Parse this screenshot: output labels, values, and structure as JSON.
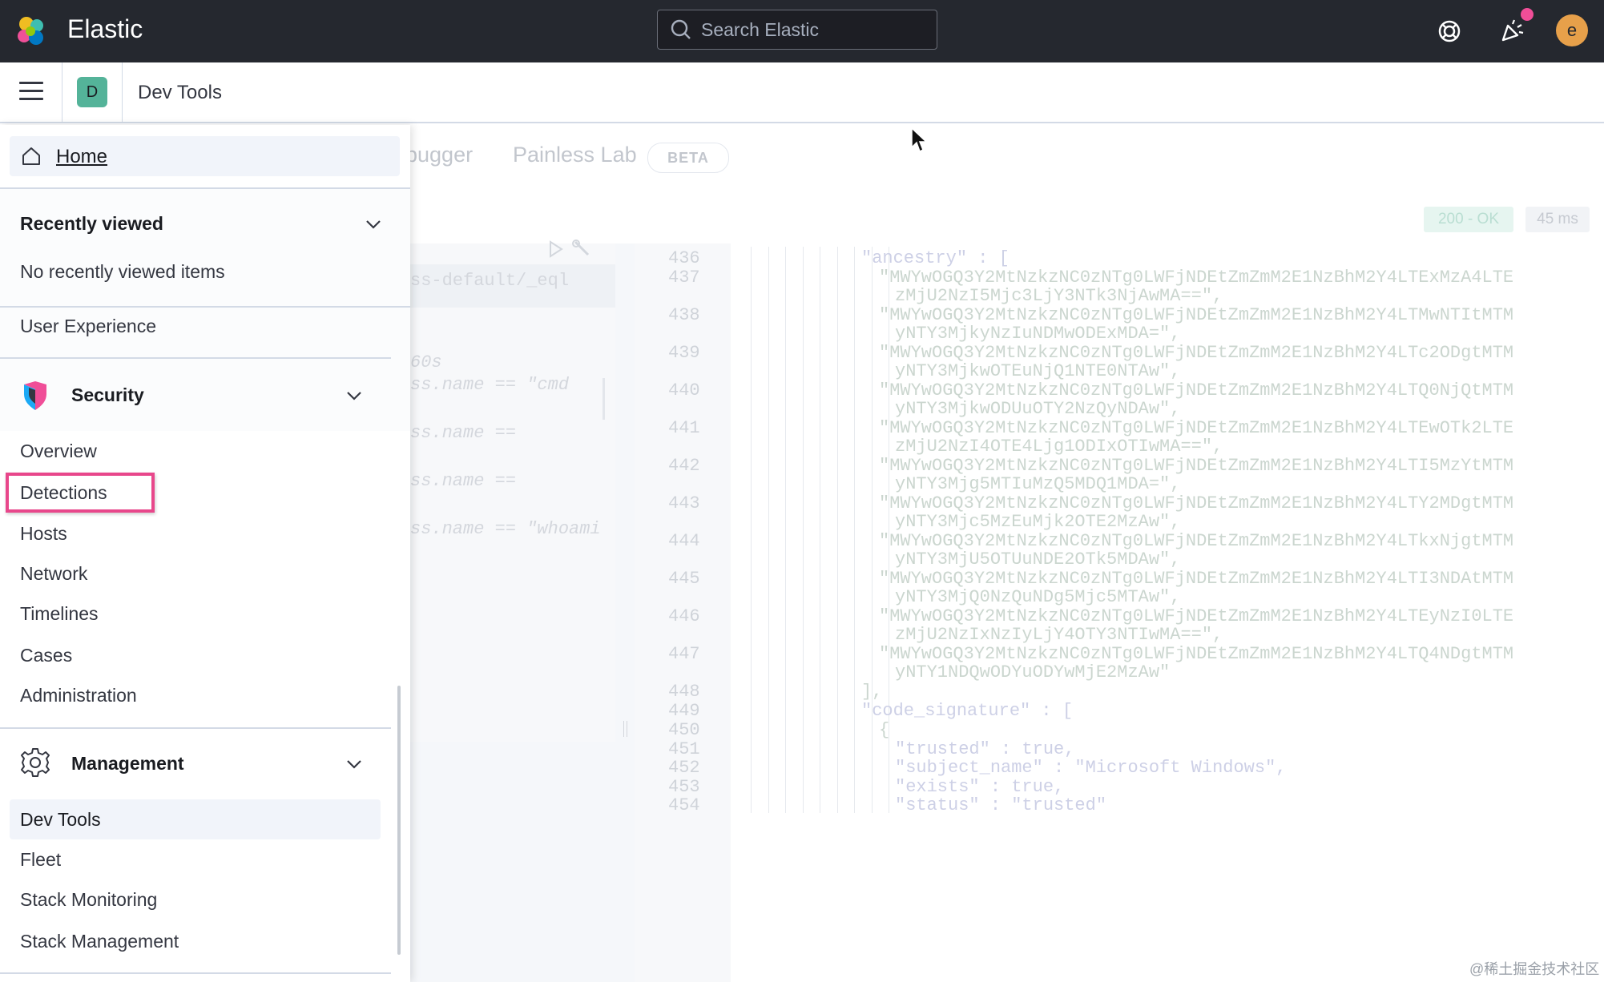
{
  "header": {
    "brand": "Elastic",
    "search_placeholder": "Search Elastic",
    "avatar_initial": "e",
    "notification_color": "#f04e98"
  },
  "subheader": {
    "space_initial": "D",
    "breadcrumb": "Dev Tools"
  },
  "sidenav": {
    "home": "Home",
    "recently_viewed": {
      "title": "Recently viewed",
      "empty": "No recently viewed items"
    },
    "observability_tail_item": "User Experience",
    "security": {
      "title": "Security",
      "items": [
        "Overview",
        "Detections",
        "Hosts",
        "Network",
        "Timelines",
        "Cases",
        "Administration"
      ],
      "highlighted": "Detections",
      "highlight_color": "#e8478b"
    },
    "management": {
      "title": "Management",
      "items": [
        "Dev Tools",
        "Fleet",
        "Stack Monitoring",
        "Stack Management"
      ],
      "active": "Dev Tools"
    }
  },
  "main": {
    "tabs": [
      "bugger",
      "Painless Lab"
    ],
    "beta_badge": "BETA",
    "status": "200 - OK",
    "latency": "45 ms",
    "request_lines": [
      "ss-default/_eql",
      "60s",
      "ss.name == \"cmd",
      "ss.name ==",
      "ss.name ==",
      "ss.name == \"whoami"
    ],
    "response_lines": [
      {
        "n": "436",
        "text": "\"ancestry\" : ["
      },
      {
        "n": "437",
        "text": "\"MWYwOGQ3Y2MtNzkzNC0zNTg0LWFjNDEtZmZmM2E1NzBhM2Y4LTExMzA4LTE",
        "cont": "zMjU2NzI5Mjc3LjY3NTk3NjAwMA==\","
      },
      {
        "n": "438",
        "text": "\"MWYwOGQ3Y2MtNzkzNC0zNTg0LWFjNDEtZmZmM2E1NzBhM2Y4LTMwNTItMTM",
        "cont": "yNTY3MjkyNzIuNDMwODExMDA=\","
      },
      {
        "n": "439",
        "text": "\"MWYwOGQ3Y2MtNzkzNC0zNTg0LWFjNDEtZmZmM2E1NzBhM2Y4LTc2ODgtMTM",
        "cont": "yNTY3MjkwOTEuNjQ1NTE0NTAw\","
      },
      {
        "n": "440",
        "text": "\"MWYwOGQ3Y2MtNzkzNC0zNTg0LWFjNDEtZmZmM2E1NzBhM2Y4LTQ0NjQtMTM",
        "cont": "yNTY3MjkwODUuOTY2NzQyNDAw\","
      },
      {
        "n": "441",
        "text": "\"MWYwOGQ3Y2MtNzkzNC0zNTg0LWFjNDEtZmZmM2E1NzBhM2Y4LTEwOTk2LTE",
        "cont": "zMjU2NzI4OTE4Ljg1ODIxOTIwMA==\","
      },
      {
        "n": "442",
        "text": "\"MWYwOGQ3Y2MtNzkzNC0zNTg0LWFjNDEtZmZmM2E1NzBhM2Y4LTI5MzYtMTM",
        "cont": "yNTY3Mjg5MTIuMzQ5MDQ1MDA=\","
      },
      {
        "n": "443",
        "text": "\"MWYwOGQ3Y2MtNzkzNC0zNTg0LWFjNDEtZmZmM2E1NzBhM2Y4LTY2MDgtMTM",
        "cont": "yNTY3Mjc5MzEuMjk2OTE2MzAw\","
      },
      {
        "n": "444",
        "text": "\"MWYwOGQ3Y2MtNzkzNC0zNTg0LWFjNDEtZmZmM2E1NzBhM2Y4LTkxNjgtMTM",
        "cont": "yNTY3MjU5OTUuNDE2OTk5MDAw\","
      },
      {
        "n": "445",
        "text": "\"MWYwOGQ3Y2MtNzkzNC0zNTg0LWFjNDEtZmZmM2E1NzBhM2Y4LTI3NDAtMTM",
        "cont": "yNTY3MjQ0NzQuNDg5Mjc5MTAw\","
      },
      {
        "n": "446",
        "text": "\"MWYwOGQ3Y2MtNzkzNC0zNTg0LWFjNDEtZmZmM2E1NzBhM2Y4LTEyNzI0LTE",
        "cont": "zMjU2NzIxNzIyLjY4OTY3NTIwMA==\","
      },
      {
        "n": "447",
        "text": "\"MWYwOGQ3Y2MtNzkzNC0zNTg0LWFjNDEtZmZmM2E1NzBhM2Y4LTQ4NDgtMTM",
        "cont": "yNTY1NDQwODYuODYwMjE2MzAw\""
      },
      {
        "n": "448",
        "text": "],"
      },
      {
        "n": "449",
        "text": "\"code_signature\" : ["
      },
      {
        "n": "450",
        "text": "{"
      },
      {
        "n": "451",
        "text": "\"trusted\" : true,"
      },
      {
        "n": "452",
        "text": "\"subject_name\" : \"Microsoft Windows\","
      },
      {
        "n": "453",
        "text": "\"exists\" : true,"
      },
      {
        "n": "454",
        "text": "\"status\" : \"trusted\""
      }
    ],
    "watermark": "@稀土掘金技术社区"
  }
}
